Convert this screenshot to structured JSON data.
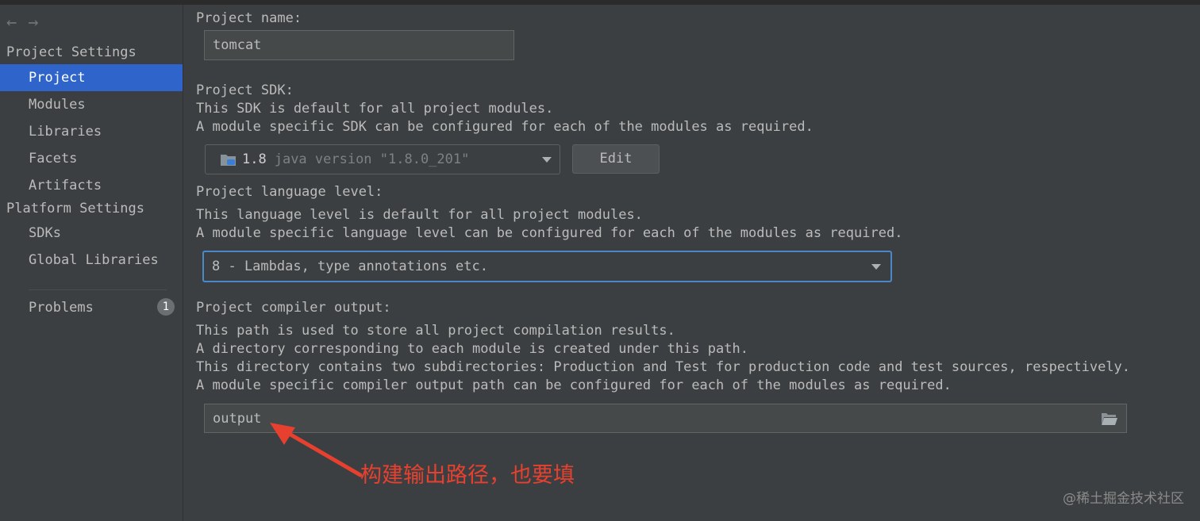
{
  "sidebar": {
    "nav": {
      "back_icon": "arrow-left-icon",
      "forward_icon": "arrow-right-icon"
    },
    "project_settings_title": "Project Settings",
    "project_items": [
      "Project",
      "Modules",
      "Libraries",
      "Facets",
      "Artifacts"
    ],
    "platform_settings_title": "Platform Settings",
    "platform_items": [
      "SDKs",
      "Global Libraries"
    ],
    "problems": {
      "label": "Problems",
      "count": "1"
    }
  },
  "main": {
    "project_name": {
      "label": "Project name:",
      "value": "tomcat"
    },
    "sdk": {
      "label": "Project SDK:",
      "desc1": "This SDK is default for all project modules.",
      "desc2": "A module specific SDK can be configured for each of the modules as required.",
      "version": "1.8",
      "detail": "java version \"1.8.0_201\"",
      "edit_label": "Edit",
      "icon": "folder-java-icon"
    },
    "language_level": {
      "label": "Project language level:",
      "desc1": "This language level is default for all project modules.",
      "desc2": "A module specific language level can be configured for each of the modules as required.",
      "value": "8 - Lambdas, type annotations etc."
    },
    "compiler_output": {
      "label": "Project compiler output:",
      "desc1": "This path is used to store all project compilation results.",
      "desc2": "A directory corresponding to each module is created under this path.",
      "desc3": "This directory contains two subdirectories: Production and Test for production code and test sources, respectively.",
      "desc4": "A module specific compiler output path can be configured for each of the modules as required.",
      "value": "output",
      "browse_icon": "folder-open-icon"
    }
  },
  "annotation": {
    "text": "构建输出路径，也要填",
    "color": "#e8402f"
  },
  "watermark": "@稀土掘金技术社区",
  "colors": {
    "selection": "#2f65ca",
    "background": "#3c3f41",
    "focus_border": "#4a88c7"
  }
}
